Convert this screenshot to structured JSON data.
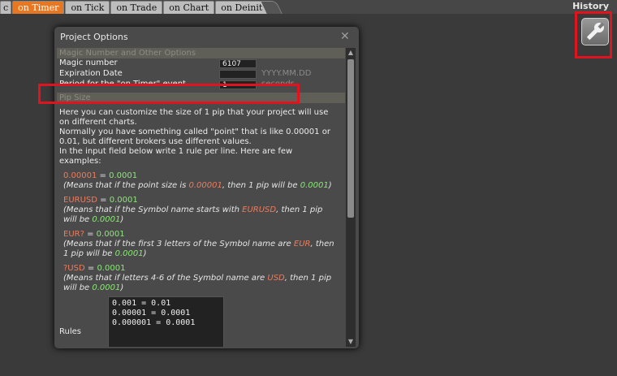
{
  "tabs": [
    "c",
    "on Timer",
    "on Tick",
    "on Trade",
    "on Chart",
    "on Deinit"
  ],
  "active_tab": "on Timer",
  "history_label": "History",
  "dialog": {
    "title": "Project Options",
    "section_magic": "Magic Number and Other Options",
    "magic_label": "Magic number",
    "magic_value": "6107",
    "expiration_label": "Expiration Date",
    "expiration_value": "",
    "expiration_hint": "YYYY.MM.DD",
    "period_label": "Period for the \"on Timer\" event",
    "period_value": "1",
    "period_hint": "seconds",
    "section_pip": "Pip Size",
    "para1": "Here you can customize the size of 1 pip that your project will use on different charts.",
    "para2": "Normally you have something called \"point\" that is like 0.00001 or 0.01, but different brokers use different values.",
    "para3": "In the input field below write 1 rule per line. Here are few examples:",
    "examples": [
      {
        "lhs": "0.00001",
        "rhs": "0.0001",
        "d1": "(Means that if the point size is ",
        "d2": "0.00001",
        "d3": ", then 1 pip will be ",
        "d4": "0.0001",
        "d5": ")"
      },
      {
        "lhs": "EURUSD",
        "rhs": "0.0001",
        "d1": "(Means that if the Symbol name starts with ",
        "d2": "EURUSD",
        "d3": ", then 1 pip will be ",
        "d4": "0.0001",
        "d5": ")"
      },
      {
        "lhs": "EUR?",
        "rhs": "0.0001",
        "d1": "(Means that if the first 3 letters of the Symbol name are ",
        "d2": "EUR",
        "d3": ", then 1 pip will be ",
        "d4": "0.0001",
        "d5": ")"
      },
      {
        "lhs": "?USD",
        "rhs": "0.0001",
        "d1": "(Means that if letters 4-6 of the Symbol name are ",
        "d2": "USD",
        "d3": ", then 1 pip will be ",
        "d4": "0.0001",
        "d5": ")"
      }
    ],
    "rules_label": "Rules",
    "rules_text": "0.001 = 0.01\n0.00001 = 0.0001\n0.000001 = 0.0001"
  },
  "colors": {
    "accent_tab": "#e87722",
    "highlight": "#e0141e"
  }
}
